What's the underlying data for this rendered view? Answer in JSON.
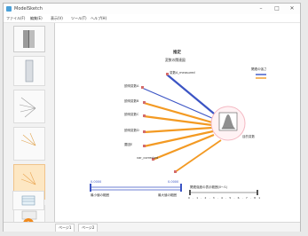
{
  "window": {
    "title": "ModelSketch",
    "min": "–",
    "max": "□",
    "close": "✕"
  },
  "menu": [
    "ファイル(F)",
    "編集(E)",
    "表示(V)",
    "ツール(T)",
    "ヘルプ(H)"
  ],
  "diagram": {
    "title": "推定",
    "subtitle": "変数の関連図",
    "legend_title": "関連の強さ",
    "target_label": "目的変数",
    "inputs": [
      {
        "label": "変数A_measured",
        "color": "#3b54c4"
      },
      {
        "label": "説明変数A",
        "color": "#f39a23"
      },
      {
        "label": "説明変数B",
        "color": "#f39a23"
      },
      {
        "label": "説明変数C",
        "color": "#f39a23"
      },
      {
        "label": "説明変数D",
        "color": "#f39a23"
      },
      {
        "label": "要因E",
        "color": "#f39a23"
      },
      {
        "label": "var_corrected",
        "color": "#f39a23"
      }
    ],
    "slider_left": {
      "start": "0.0000",
      "end": "0.0000",
      "caption_left": "最小値の範囲",
      "caption_right": "最大値の範囲",
      "value_fraction": 0.92
    },
    "slider_right": {
      "caption": "関連強度の表示範囲(0〜1)",
      "ticks": [
        "0",
        ".1",
        ".2",
        ".3",
        ".4",
        ".5",
        ".6",
        ".7",
        ".8",
        "1"
      ]
    }
  },
  "tabs": [
    "ページ1",
    "ページ2"
  ],
  "colors": {
    "positive": "#3b54c4",
    "negative": "#f39a23",
    "node_ring": "#f4b8c2",
    "selected_thumb": "#fde7c3",
    "accent_button": "#f08a1d"
  },
  "icons": [
    "app-icon",
    "minimize-icon",
    "maximize-icon",
    "close-icon",
    "pie-icon",
    "add-icon"
  ]
}
